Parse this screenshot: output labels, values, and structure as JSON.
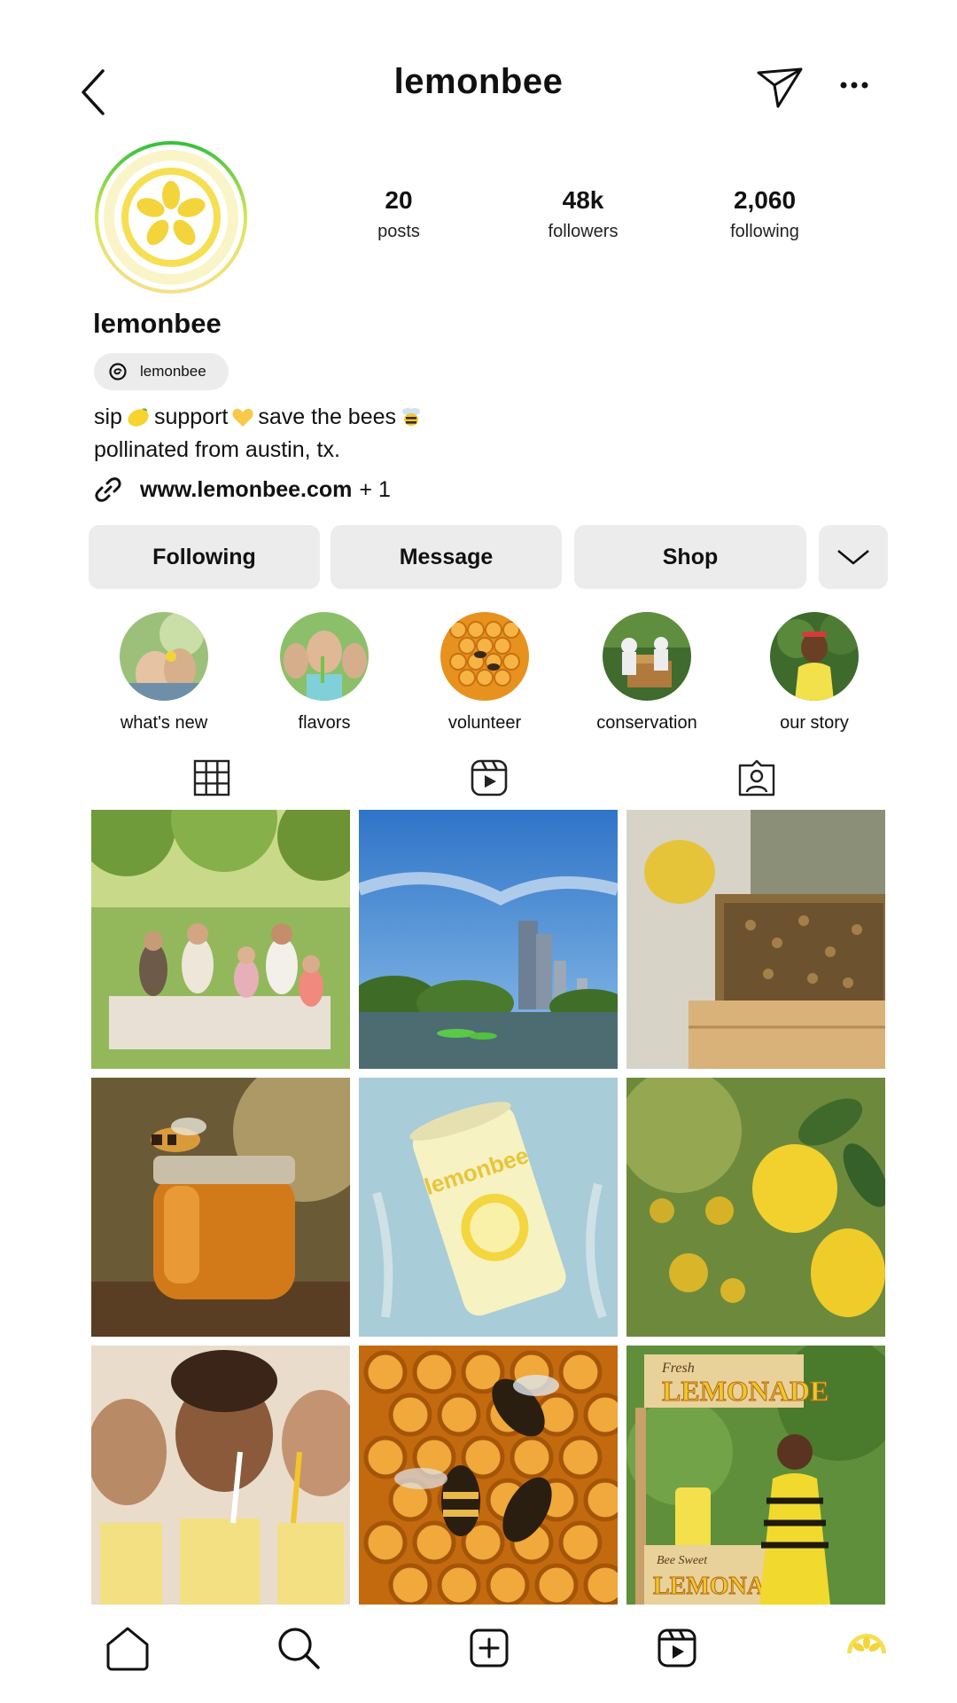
{
  "header": {
    "title": "lemonbee",
    "back_icon": "chevron-left-icon",
    "send_icon": "paper-plane-icon",
    "more_icon": "more-dots-icon"
  },
  "profile": {
    "username": "lemonbee",
    "stats": [
      {
        "value": "20",
        "label": "posts"
      },
      {
        "value": "48k",
        "label": "followers"
      },
      {
        "value": "2,060",
        "label": "following"
      }
    ],
    "threads_handle": "lemonbee",
    "bio_line1_parts": [
      "sip",
      "support",
      "save the bees"
    ],
    "bio_line2": "pollinated from austin, tx.",
    "link_url": "www.lemonbee.com",
    "link_extra": "+ 1"
  },
  "actions": {
    "following": "Following",
    "message": "Message",
    "shop": "Shop"
  },
  "highlights": [
    {
      "label": "what's new"
    },
    {
      "label": "flavors"
    },
    {
      "label": "volunteer"
    },
    {
      "label": "conservation"
    },
    {
      "label": "our story"
    }
  ],
  "can_text": "lemonbee",
  "sign_text": {
    "top_small": "Fresh",
    "top_big": "LEMONADE",
    "bottom_small": "Bee Sweet",
    "bottom_big": "LEMONADE"
  },
  "colors": {
    "accent_yellow": "#f2d84a",
    "avatar_ring_green": "#3cc13b",
    "button_bg": "#ececec"
  }
}
